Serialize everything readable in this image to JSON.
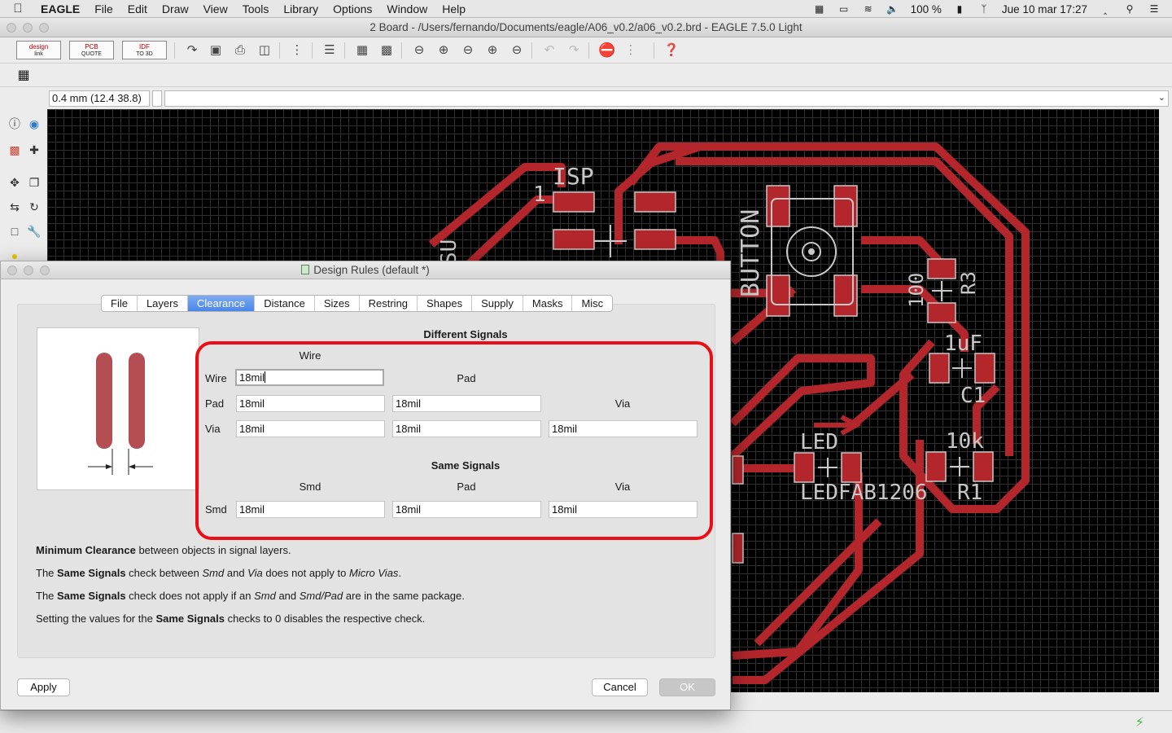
{
  "menubar": {
    "app": "EAGLE",
    "items": [
      "File",
      "Edit",
      "Draw",
      "View",
      "Tools",
      "Library",
      "Options",
      "Window",
      "Help"
    ],
    "battery": "100 %",
    "datetime": "Jue 10 mar  17:27"
  },
  "main_window": {
    "title": "2 Board - /Users/fernando/Documents/eagle/A06_v0.2/a06_v0.2.brd - EAGLE 7.5.0 Light"
  },
  "toolbar": {
    "design_link_top": "design",
    "design_link_bottom": "link",
    "pcb_quote_top": "PCB",
    "pcb_quote_bottom": "QUOTE",
    "idf_top": "IDF",
    "idf_bottom": "TO 3D"
  },
  "command_line": {
    "coordinates": "0.4 mm (12.4 38.8)",
    "value": ""
  },
  "board_labels": {
    "isp": "ISP",
    "pin1": "1",
    "button": "BUTTON",
    "r3_value": "100",
    "r3": "R3",
    "c1_value": "1uF",
    "c1": "C1",
    "led": "LED",
    "led_package": "LEDFAB1206",
    "r1_value": "10k",
    "r1": "R1",
    "partial": "SU"
  },
  "dialog": {
    "title": "Design Rules (default *)",
    "tabs": [
      {
        "label": "File",
        "active": false
      },
      {
        "label": "Layers",
        "active": false
      },
      {
        "label": "Clearance",
        "active": true
      },
      {
        "label": "Distance",
        "active": false
      },
      {
        "label": "Sizes",
        "active": false
      },
      {
        "label": "Restring",
        "active": false
      },
      {
        "label": "Shapes",
        "active": false
      },
      {
        "label": "Supply",
        "active": false
      },
      {
        "label": "Masks",
        "active": false
      },
      {
        "label": "Misc",
        "active": false
      }
    ],
    "different_signals": {
      "title": "Different Signals",
      "col_wire": "Wire",
      "col_pad": "Pad",
      "col_via": "Via",
      "row_wire": "Wire",
      "row_pad": "Pad",
      "row_via": "Via",
      "wire_wire": "18mil",
      "pad_wire": "18mil",
      "pad_pad": "18mil",
      "via_wire": "18mil",
      "via_pad": "18mil",
      "via_via": "18mil"
    },
    "same_signals": {
      "title": "Same Signals",
      "col_smd": "Smd",
      "col_pad": "Pad",
      "col_via": "Via",
      "row_smd": "Smd",
      "smd_smd": "18mil",
      "smd_pad": "18mil",
      "smd_via": "18mil"
    },
    "description": {
      "l1_b": "Minimum Clearance",
      "l1_t": " between objects in signal layers.",
      "l2_a": "The ",
      "l2_b": "Same Signals",
      "l2_c": " check between ",
      "l2_d": "Smd",
      "l2_e": " and ",
      "l2_f": "Via",
      "l2_g": " does not apply to ",
      "l2_h": "Micro Vias",
      "l2_i": ".",
      "l3_a": "The ",
      "l3_b": "Same Signals",
      "l3_c": " check does not apply if an ",
      "l3_d": "Smd",
      "l3_e": " and ",
      "l3_f": "Smd/Pad",
      "l3_g": " are in the same package.",
      "l4_a": "Setting the values for the ",
      "l4_b": "Same Signals",
      "l4_c": " checks to 0 disables the respective check."
    },
    "buttons": {
      "apply": "Apply",
      "cancel": "Cancel",
      "ok": "OK"
    }
  },
  "colors": {
    "trace": "#b3262b",
    "highlight": "#ea0f14",
    "active_tab": "#4a86ea",
    "silkscreen": "#c8c8c8"
  }
}
